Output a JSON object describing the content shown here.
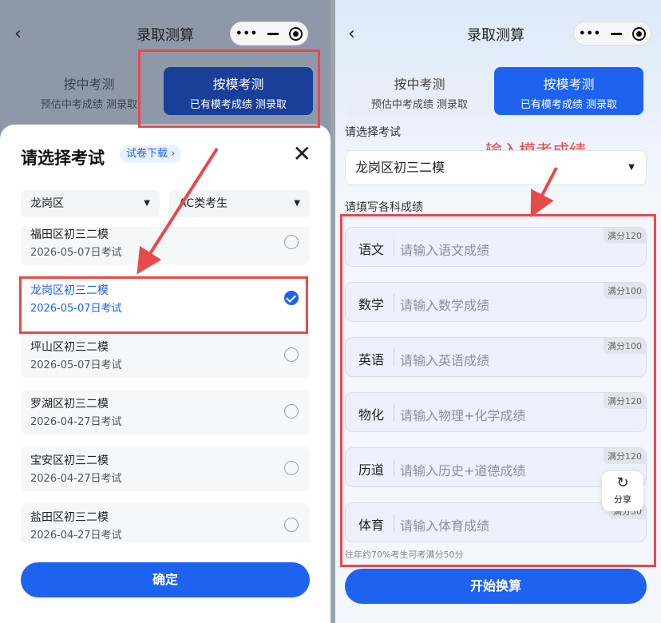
{
  "left": {
    "title": "录取测算",
    "tabs": [
      {
        "label": "按中考测",
        "desc": "预估中考成绩 测录取"
      },
      {
        "label": "按模考测",
        "desc": "已有模考成绩 测录取"
      }
    ],
    "sheet": {
      "title": "请选择考试",
      "download": "试卷下载 ›",
      "district": "龙岗区",
      "category": "AC类考生",
      "exams": [
        {
          "name": "福田区初三二模",
          "date": "2026-05-07日考试",
          "selected": false
        },
        {
          "name": "龙岗区初三二模",
          "date": "2026-05-07日考试",
          "selected": true
        },
        {
          "name": "坪山区初三二模",
          "date": "2026-05-07日考试",
          "selected": false
        },
        {
          "name": "罗湖区初三二模",
          "date": "2026-04-27日考试",
          "selected": false
        },
        {
          "name": "宝安区初三二模",
          "date": "2026-04-27日考试",
          "selected": false
        },
        {
          "name": "盐田区初三二模",
          "date": "2026-04-27日考试",
          "selected": false
        }
      ],
      "confirm": "确定"
    }
  },
  "right": {
    "title": "录取测算",
    "tabs": [
      {
        "label": "按中考测",
        "desc": "预估中考成绩 测录取"
      },
      {
        "label": "按模考测",
        "desc": "已有模考成绩 测录取"
      }
    ],
    "exam_label": "请选择考试",
    "exam_value": "龙岗区初三二模",
    "annotation": "输入模考成绩",
    "scores_label": "请填写各科成绩",
    "subjects": [
      {
        "name": "语文",
        "placeholder": "请输入语文成绩",
        "max": "满分120"
      },
      {
        "name": "数学",
        "placeholder": "请输入数学成绩",
        "max": "满分100"
      },
      {
        "name": "英语",
        "placeholder": "请输入英语成绩",
        "max": "满分100"
      },
      {
        "name": "物化",
        "placeholder": "请输入物理+化学成绩",
        "max": "满分120"
      },
      {
        "name": "历道",
        "placeholder": "请输入历史+道德成绩",
        "max": "满分120"
      },
      {
        "name": "体育",
        "placeholder": "请输入体育成绩",
        "max": "满分50"
      }
    ],
    "hint": "往年约70%考生可考满分50分",
    "share": "分享",
    "start": "开始换算"
  },
  "colors": {
    "primary": "#1d63f0",
    "annotation_red": "#e64a4a"
  }
}
